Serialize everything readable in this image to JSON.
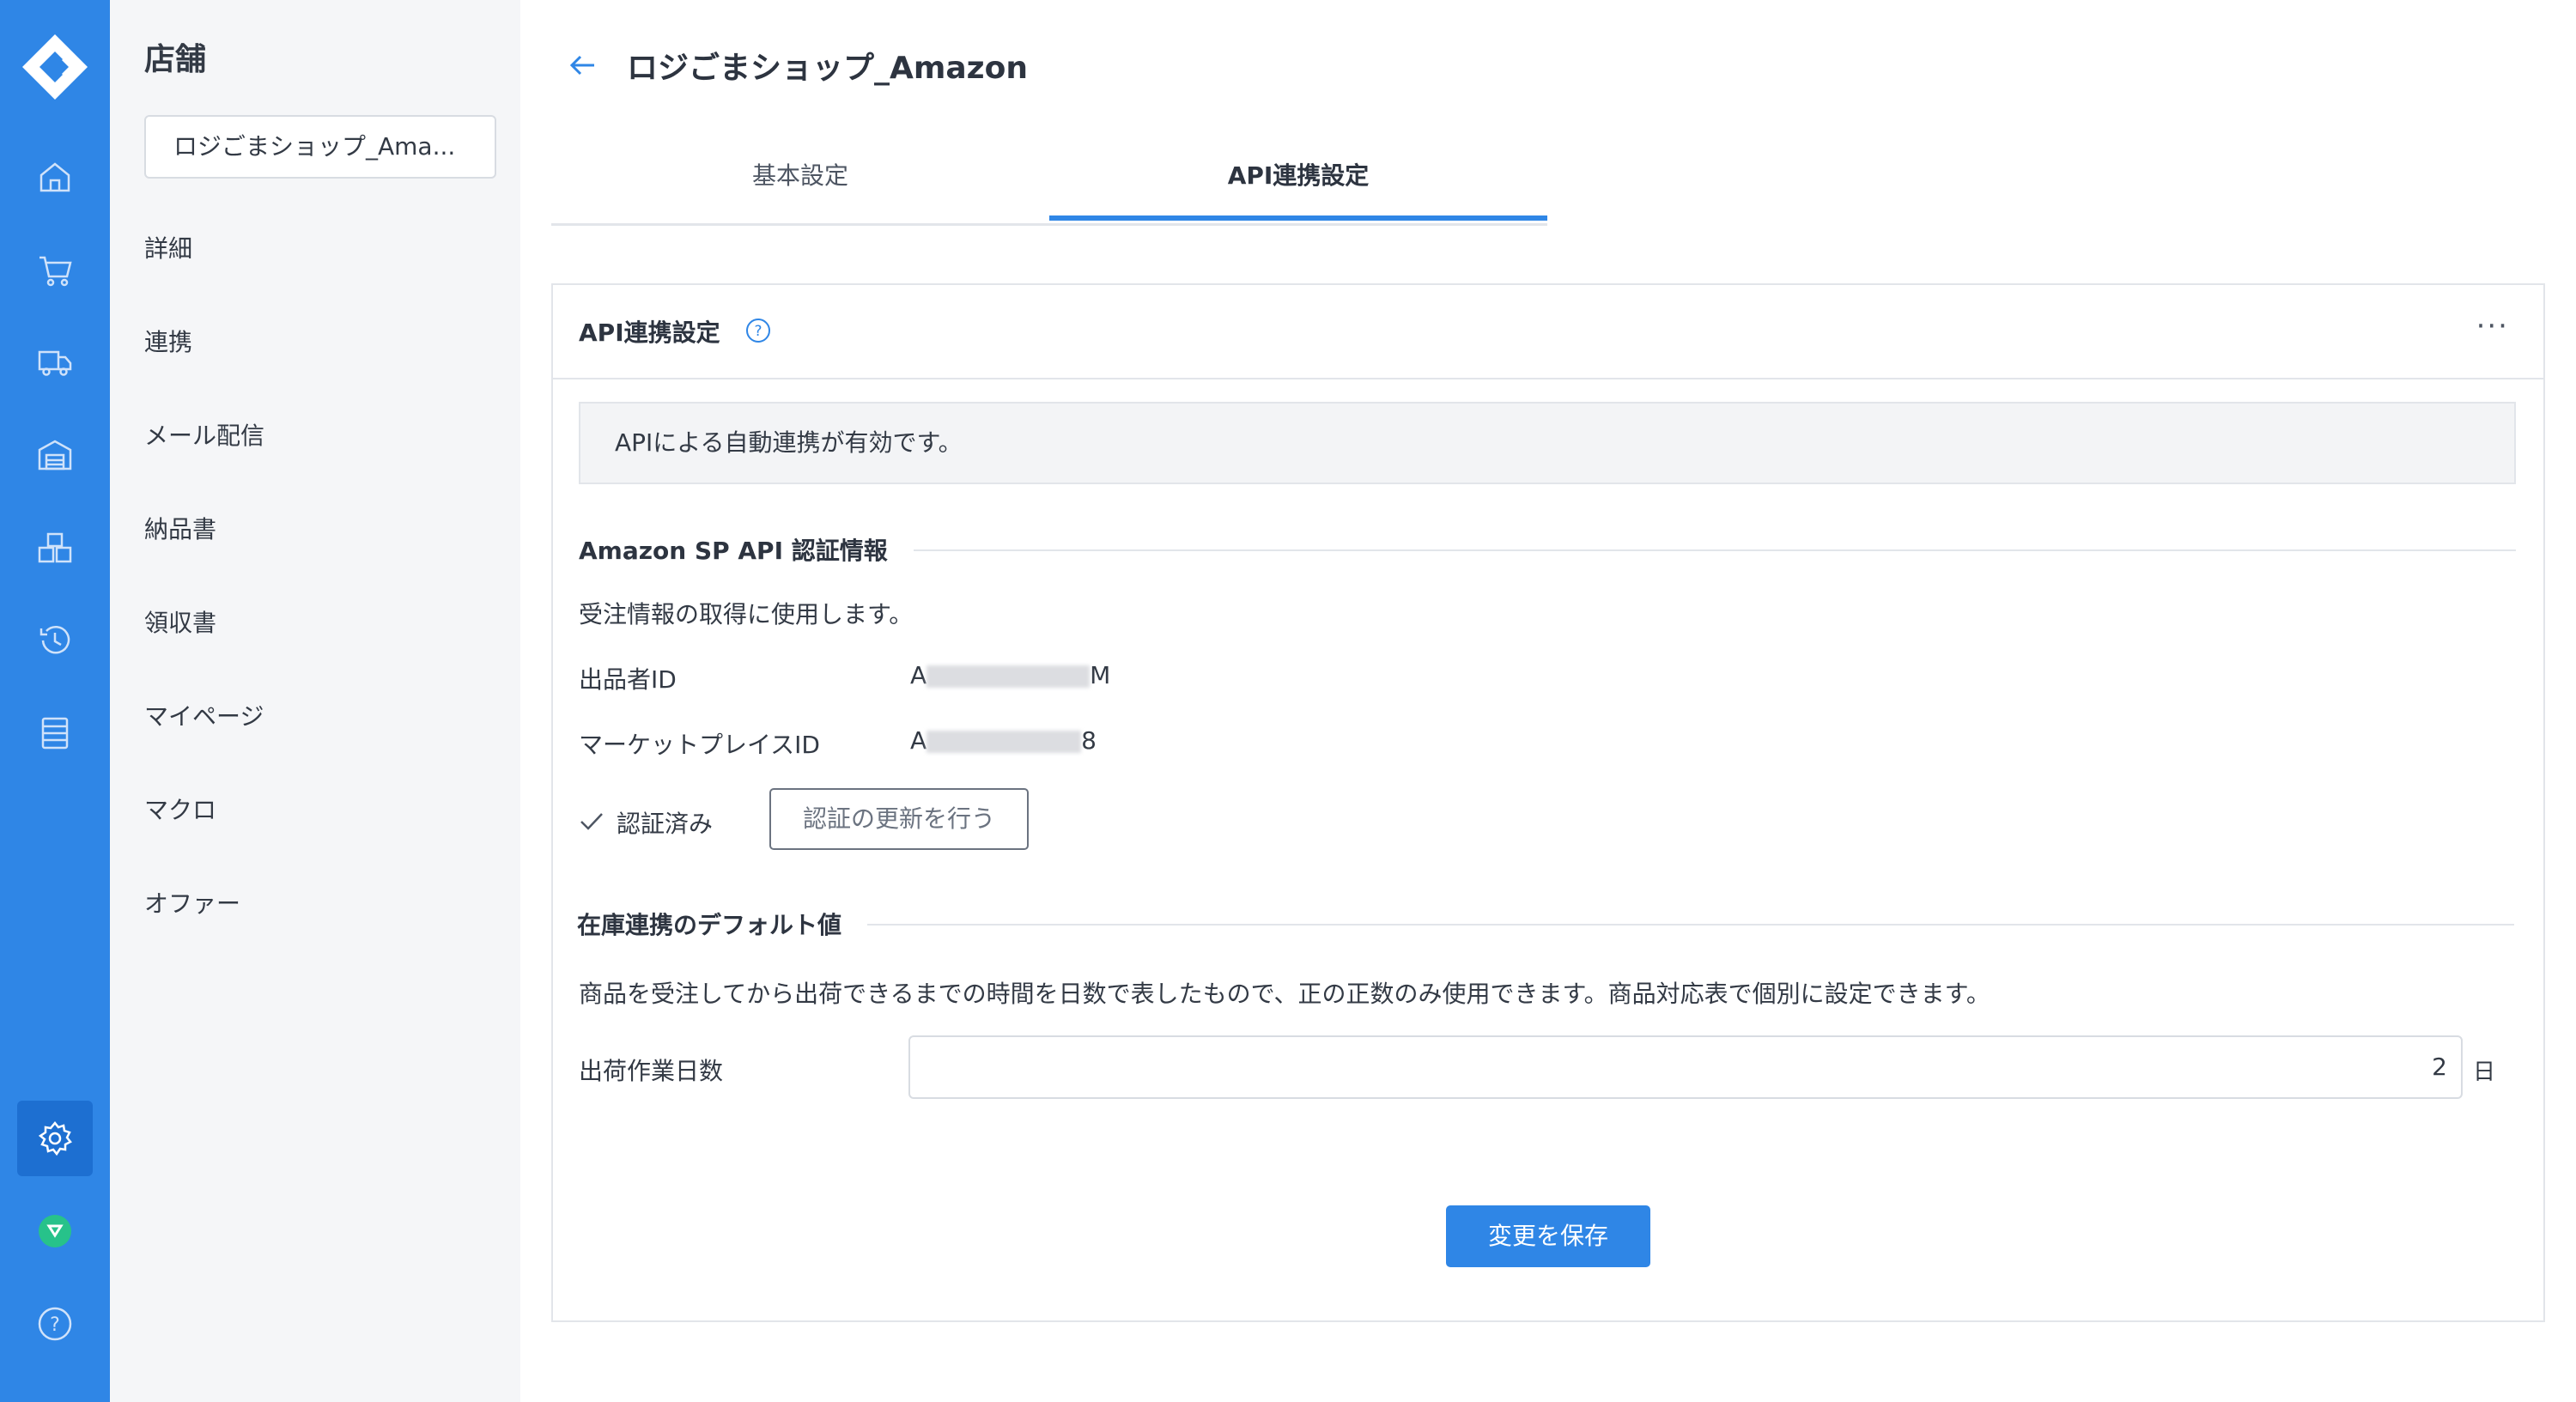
{
  "nav_rail": {
    "items": [
      "logo-icon",
      "home-icon",
      "cart-icon",
      "truck-icon",
      "warehouse-icon",
      "boxes-icon",
      "history-icon",
      "list-icon",
      "gear-icon",
      "app-icon",
      "help-icon"
    ],
    "accent": "#2f86e6",
    "active_bg": "#1d6fd1"
  },
  "sidebar": {
    "title": "店舗",
    "store_select": "ロジごまショップ_Ama...",
    "items": [
      "詳細",
      "連携",
      "メール配信",
      "納品書",
      "領収書",
      "マイページ",
      "マクロ",
      "オファー"
    ]
  },
  "header": {
    "page_title": "ロジごまショップ_Amazon",
    "tabs": [
      "基本設定",
      "API連携設定"
    ],
    "active_tab": "API連携設定"
  },
  "panel": {
    "title": "API連携設定",
    "more": "···",
    "notice": "APIによる自動連携が有効です。",
    "auth_section": {
      "heading": "Amazon SP API 認証情報",
      "description": "受注情報の取得に使用します。",
      "seller_id_label": "出品者ID",
      "seller_id_prefix": "A",
      "seller_id_suffix": "M",
      "marketplace_id_label": "マーケットプレイスID",
      "marketplace_id_prefix": "A",
      "marketplace_id_suffix": "8",
      "status": "認証済み",
      "renew_button": "認証の更新を行う"
    },
    "inventory_section": {
      "heading": "在庫連携のデフォルト値",
      "description": "商品を受注してから出荷できるまでの時間を日数で表したもので、正の正数のみ使用できます。商品対応表で個別に設定できます。",
      "shipping_days_label": "出荷作業日数",
      "shipping_days_value": "2",
      "shipping_days_unit": "日"
    },
    "save_button": "変更を保存"
  }
}
